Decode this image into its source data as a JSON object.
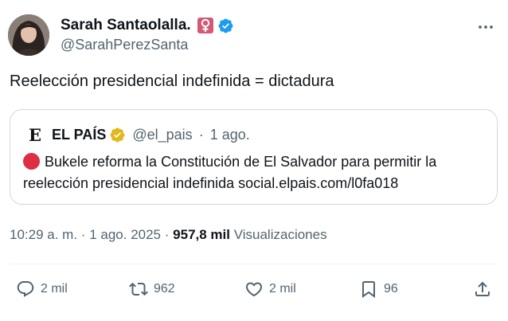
{
  "author": {
    "display_name": "Sarah Santaolalla.",
    "handle": "@SarahPerezSanta",
    "badge_symbol": "♀",
    "badge_color": "#d35a73",
    "verified_color": "#1d9bf0"
  },
  "tweet": {
    "text": "Reelección presidencial indefinida = dictadura"
  },
  "quote": {
    "logo_text": "E",
    "name": "EL PAÍS",
    "handle": "@el_pais",
    "separator": "·",
    "time": "1 ago.",
    "body": "Bukele reforma la Constitución de El Salvador para permitir la reelección presidencial indefinida social.elpais.com/l0fa018",
    "verified_color": "#e2b719"
  },
  "meta": {
    "time": "10:29 a. m.",
    "sep1": "·",
    "date": "1 ago. 2025",
    "sep2": "·",
    "views_count": "957,8 mil",
    "views_label": "Visualizaciones"
  },
  "actions": {
    "replies": "2 mil",
    "reposts": "962",
    "likes": "2 mil",
    "bookmarks": "96"
  },
  "colors": {
    "text_primary": "#0f1419",
    "text_secondary": "#536471",
    "border": "#cfd9de",
    "divider": "#eff3f4",
    "red_circle": "#dd2e44"
  },
  "icons": {
    "more": "more-icon",
    "reply": "reply-icon",
    "repost": "repost-icon",
    "like": "heart-icon",
    "bookmark": "bookmark-icon",
    "share": "share-icon"
  }
}
